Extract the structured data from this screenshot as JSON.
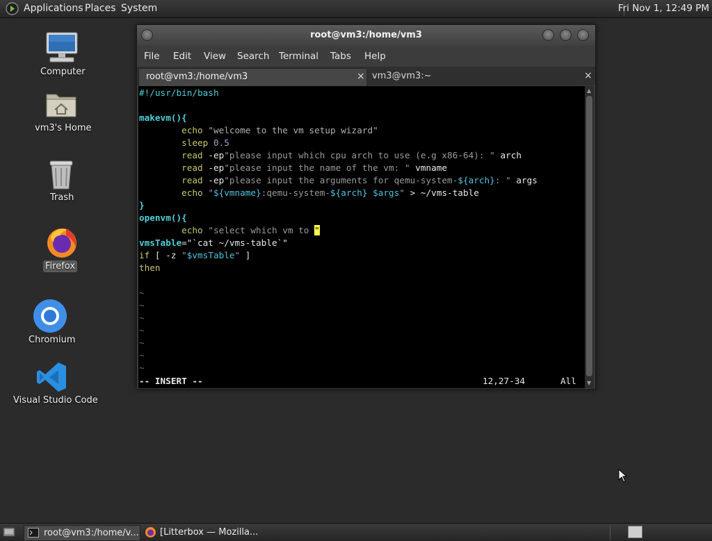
{
  "top_panel": {
    "menu": [
      "Applications",
      "Places",
      "System"
    ],
    "clock": "Fri Nov 1, 12:49 PM"
  },
  "desktop_icons": [
    {
      "label": "Computer",
      "icon": "computer-icon"
    },
    {
      "label": "vm3's Home",
      "icon": "home-folder-icon"
    },
    {
      "label": "Trash",
      "icon": "trash-icon"
    },
    {
      "label": "Firefox",
      "icon": "firefox-icon"
    },
    {
      "label": "Chromium",
      "icon": "chromium-icon"
    },
    {
      "label": "Visual Studio Code",
      "icon": "vscode-icon"
    }
  ],
  "terminal": {
    "title": "root@vm3:/home/vm3",
    "menu": [
      "File",
      "Edit",
      "View",
      "Search",
      "Terminal",
      "Tabs",
      "Help"
    ],
    "tabs": [
      {
        "label": "root@vm3:/home/vm3",
        "close": "×"
      },
      {
        "label": "vm3@vm3:~",
        "close": "×"
      }
    ],
    "code": {
      "l1": "#!/usr/bin/bash",
      "l3": "makevm(){",
      "l4_cmd": "echo",
      "l4_str": "\"welcome to the vm setup wizard\"",
      "l5_cmd": "sleep",
      "l5_num": "0.5",
      "l6_cmd": "read",
      "l6_flag": "-ep",
      "l6_str": "\"please input which cpu arch to use (e.g x86-64): \"",
      "l6_arg": "arch",
      "l7_cmd": "read",
      "l7_flag": "-ep",
      "l7_str": "\"please input the name of the vm: \"",
      "l7_arg": "vmname",
      "l8_cmd": "read",
      "l8_flag": "-ep",
      "l8_str1": "\"please input the arguments for qemu-system-",
      "l8_var": "${arch}",
      "l8_str2": ": \"",
      "l8_arg": "args",
      "l9_cmd": "echo",
      "l9_q1": "\"",
      "l9_var1": "${vmname}",
      "l9_mid": ":qemu-system-",
      "l9_var2": "${arch}",
      "l9_sp": " ",
      "l9_var3": "$args",
      "l9_q2": "\"",
      "l9_rest": " > ~/vms-table",
      "l10": "}",
      "l11": "openvm(){",
      "l12_cmd": "echo",
      "l12_str": "\"select which vm to ",
      "l12_cursor": "\"",
      "l13_var": "vmsTable",
      "l13_rest": "=\"`cat ~/vms-table`\"",
      "l14_kw": "if",
      "l14_a": " [ -z ",
      "l14_q1": "\"",
      "l14_var": "$vmsTable",
      "l14_q2": "\"",
      "l14_b": " ]",
      "l15_kw": "then",
      "tilde": "~"
    },
    "status_mode": "-- INSERT --",
    "status_pos": "12,27-34",
    "status_scroll": "All"
  },
  "taskbar": {
    "tasks": [
      {
        "label": "root@vm3:/home/v...",
        "icon": "terminal-icon"
      },
      {
        "label": "[Litterbox — Mozilla...",
        "icon": "firefox-icon"
      }
    ]
  }
}
